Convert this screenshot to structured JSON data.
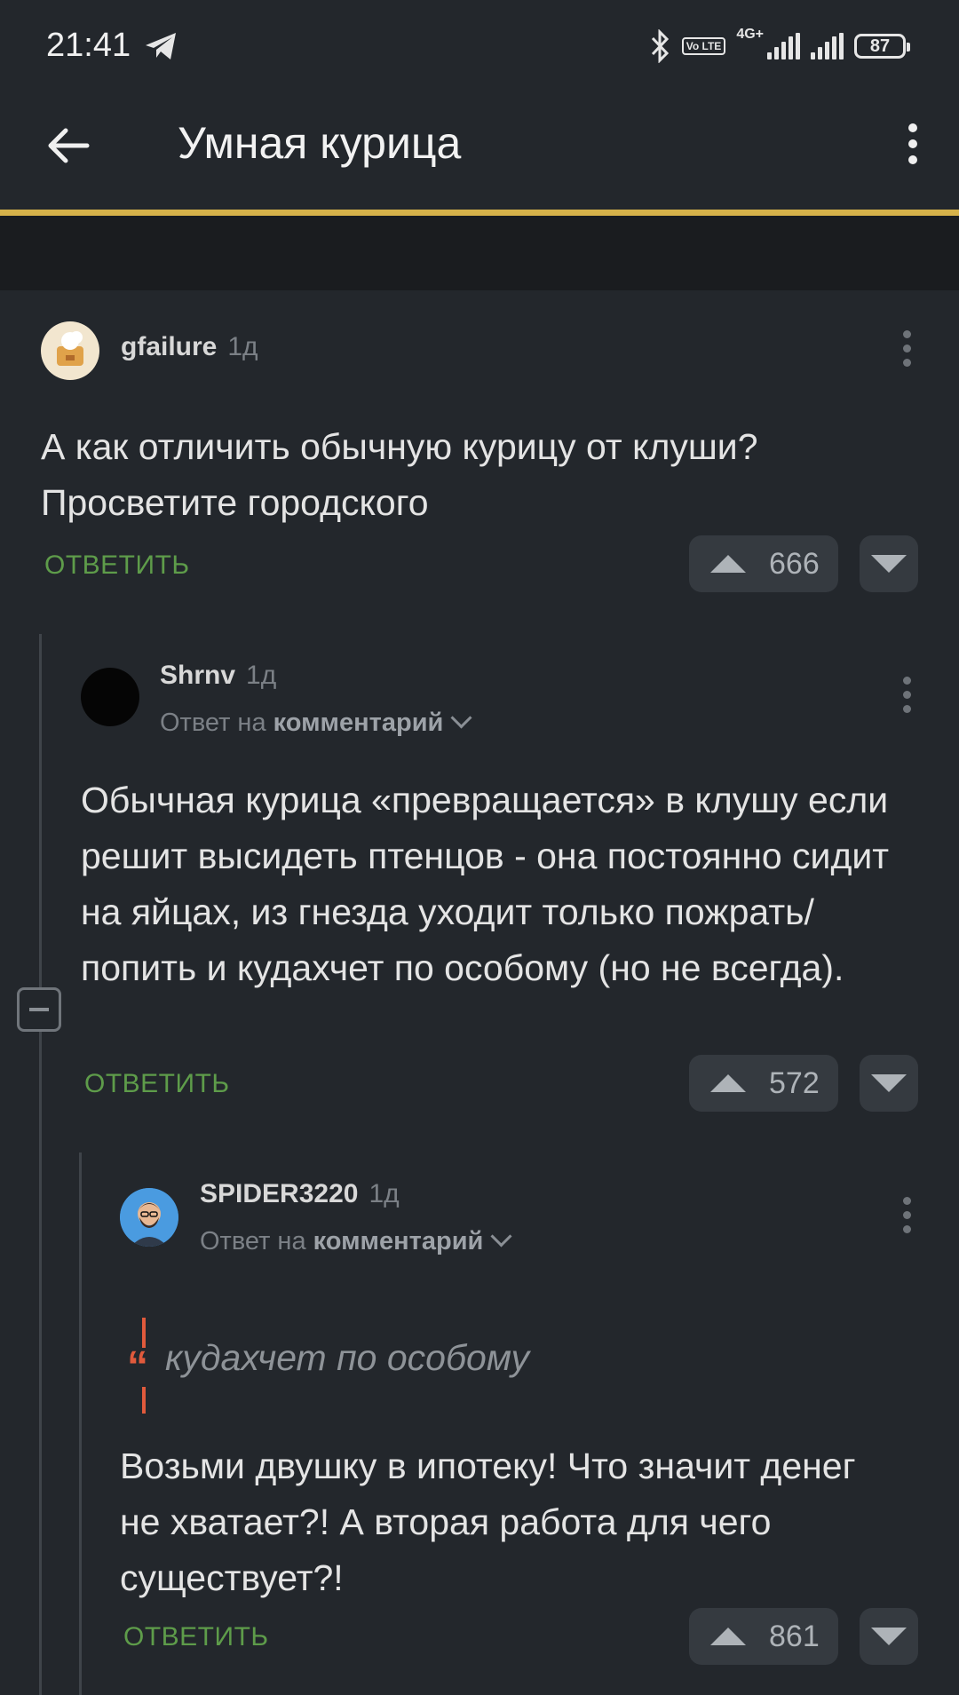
{
  "status": {
    "time": "21:41",
    "network": "4G+",
    "volte": "Vo LTE",
    "battery": "87"
  },
  "header": {
    "title": "Умная курица"
  },
  "comments": [
    {
      "author": "gfailure",
      "age": "1д",
      "text": "А как отличить обычную курицу от клуши? Просветите городского",
      "reply_label": "ОТВЕТИТЬ",
      "votes": "666"
    },
    {
      "author": "Shrnv",
      "age": "1д",
      "reply_prefix": "Ответ на",
      "reply_target": "комментарий",
      "text": "Обычная курица «превращается» в клушу если решит высидеть птенцов - она постоянно сидит на яйцах, из гнезда уходит только пожрать/попить и кудахчет по особому (но не всегда).",
      "reply_label": "ОТВЕТИТЬ",
      "votes": "572"
    },
    {
      "author": "SPIDER3220",
      "age": "1д",
      "reply_prefix": "Ответ на",
      "reply_target": "комментарий",
      "quote": "кудахчет по особому",
      "text": "Возьми двушку в ипотеку! Что значит денег не хватает?! А вторая работа для чего существует?!",
      "reply_label": "ОТВЕТИТЬ",
      "votes": "861"
    }
  ],
  "icons": {
    "back": "arrow-left-icon",
    "menu": "kebab-menu-icon",
    "upvote": "triangle-up-icon",
    "downvote": "triangle-down-icon",
    "collapse": "minus-square-icon",
    "quote": "quote-icon"
  },
  "colors": {
    "background": "#23272c",
    "accent": "#d6b24a",
    "reply_green": "#5e9c4a",
    "quote_red": "#e05a3c"
  }
}
